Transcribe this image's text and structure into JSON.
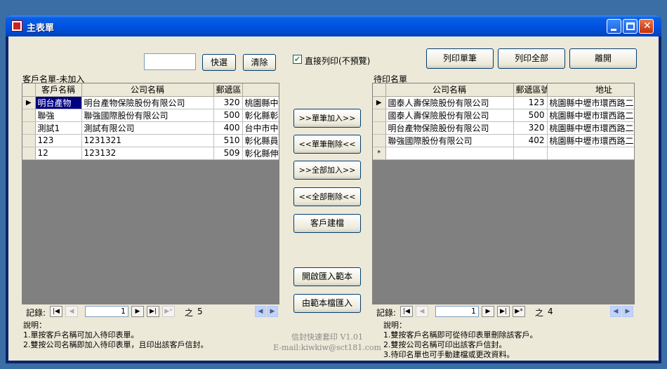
{
  "window": {
    "title": "主表單"
  },
  "toolbar": {
    "search_value": "",
    "quick_select_label": "快選",
    "clear_label": "清除",
    "direct_print_label": "直接列印(不預覽)",
    "direct_print_checked": "✔",
    "print_single_label": "列印單筆",
    "print_all_label": "列印全部",
    "exit_label": "離開"
  },
  "left_grid": {
    "caption": "客戶名單-未加入",
    "columns": [
      "客戶名稱",
      "公司名稱",
      "郵遞區",
      ""
    ],
    "rows": [
      [
        "明台產物",
        "明台產物保險股份有限公司",
        "320",
        "桃園縣中"
      ],
      [
        "聯強",
        "聯強國際股份有限公司",
        "500",
        "彰化縣彰"
      ],
      [
        "測試1",
        "測試有限公司",
        "400",
        "台中市中"
      ],
      [
        "123",
        "1231321",
        "510",
        "彰化縣員"
      ],
      [
        "12",
        "123132",
        "509",
        "彰化縣伸"
      ]
    ],
    "nav": {
      "label": "記錄:",
      "current": "1",
      "of": "之",
      "total": "5"
    }
  },
  "middle_buttons": {
    "add_one": ">>單筆加入>>",
    "remove_one": "<<單筆刪除<<",
    "add_all": ">>全部加入>>",
    "remove_all": "<<全部刪除<<",
    "create_customer": "客戶建檔",
    "open_template": "開啟匯入範本",
    "import_template": "由範本檔匯入"
  },
  "right_grid": {
    "caption": "待印名單",
    "columns": [
      "公司名稱",
      "郵遞區號",
      "地址"
    ],
    "rows": [
      [
        "國泰人壽保險股份有限公司",
        "123",
        "桃園縣中壢市環西路二"
      ],
      [
        "國泰人壽保險股份有限公司",
        "500",
        "桃園縣中壢市環西路二"
      ],
      [
        "明台產物保險股份有限公司",
        "320",
        "桃園縣中壢市環西路二"
      ],
      [
        "聯強國際股份有限公司",
        "402",
        "桃園縣中壢市環西路二"
      ]
    ],
    "new_row_marker": "*",
    "nav": {
      "label": "記錄:",
      "current": "1",
      "of": "之",
      "total": "4"
    }
  },
  "notes": {
    "left": [
      "說明：",
      "1.單按客戶名稱可加入待印表單。",
      "2.雙按公司名稱即加入待印表單，且印出該客戶信封。"
    ],
    "right": [
      "說明：",
      "1.雙按客戶名稱即可從待印表單刪除該客戶。",
      "2.雙按公司名稱可印出該客戶信封。",
      "3.待印名單也可手動建檔或更改資料。"
    ]
  },
  "footer": {
    "app_version": "信封快速套印 V1.01",
    "email": "E-mail:kiwkiw@sct181.com"
  },
  "colors": {
    "titlebar": "#0054e3",
    "grid_bg": "#808080",
    "selection": "#000080"
  }
}
